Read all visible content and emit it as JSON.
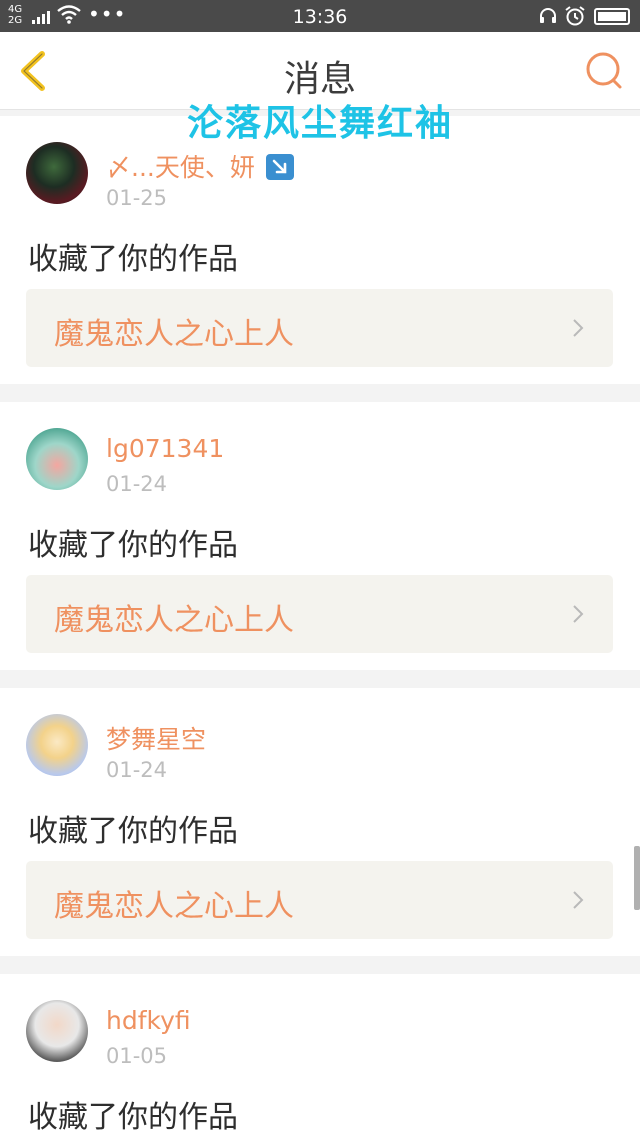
{
  "status_bar": {
    "network_top": "4G",
    "network_bottom": "2G",
    "dots": "•••",
    "time": "13:36"
  },
  "header": {
    "title": "消息"
  },
  "watermark": "沦落风尘舞红袖",
  "colors": {
    "accent": "#ef9160",
    "watermark": "#1ec3e6",
    "back_arrow": "#f2c21f"
  },
  "messages": [
    {
      "username": "〆...天使、妍",
      "date": "01-25",
      "action": "收藏了你的作品",
      "work_title": "魔鬼恋人之心上人"
    },
    {
      "username": "lg071341",
      "date": "01-24",
      "action": "收藏了你的作品",
      "work_title": "魔鬼恋人之心上人"
    },
    {
      "username": "梦舞星空",
      "date": "01-24",
      "action": "收藏了你的作品",
      "work_title": "魔鬼恋人之心上人"
    },
    {
      "username": "hdfkyfi",
      "date": "01-05",
      "action": "收藏了你的作品"
    }
  ]
}
